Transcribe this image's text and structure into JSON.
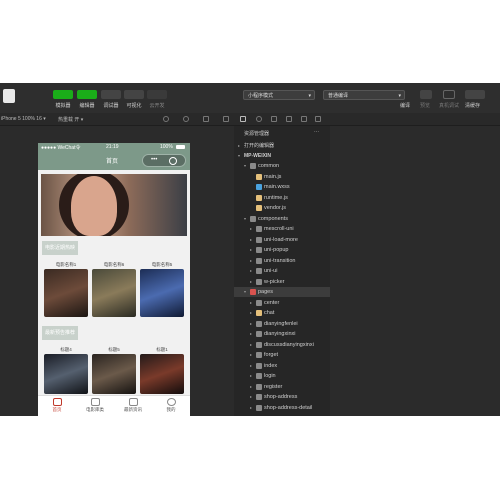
{
  "toolbar": {
    "buttons": [
      {
        "label": "模拟器",
        "color": "#1aad19",
        "glyph": "▯"
      },
      {
        "label": "编辑器",
        "color": "#1aad19",
        "glyph": "</>"
      },
      {
        "label": "调试器",
        "color": "#444444",
        "glyph": "⇆"
      },
      {
        "label": "可视化",
        "color": "#444444",
        "glyph": "▤"
      },
      {
        "label": "云开发",
        "color": "#3a3a3a",
        "glyph": "☁"
      }
    ],
    "mode_select": "小程序模式",
    "compile_select": "普通编译",
    "right_labels": [
      "编译",
      "预览",
      "真机调试",
      "清缓存"
    ]
  },
  "subbar": {
    "device": "iPhone 5 100% 16 ▾",
    "hotreload": "热重载 开 ▾",
    "explorer_title": "资源管理器",
    "explorer_more": "···"
  },
  "phone": {
    "carrier": "●●●●● WeChat令",
    "time": "21:19",
    "battery": "100%",
    "nav_title": "首页",
    "capsule_dots": "•••",
    "section1": "电影近期热映",
    "section2": "最新预告推荐",
    "row1": [
      "电影名称1",
      "电影名称6",
      "电影名称5"
    ],
    "row2": [
      "标题4",
      "标题5",
      "标题1"
    ],
    "tabs": [
      "首页",
      "电影库类",
      "最新资讯",
      "我的"
    ]
  },
  "explorer": {
    "open_editors": "打开的编辑器",
    "project": "MP-WEIXIN",
    "tree": [
      {
        "name": "common",
        "level": 1,
        "type": "folder-open"
      },
      {
        "name": "main.js",
        "level": 2,
        "type": "js"
      },
      {
        "name": "main.wxss",
        "level": 2,
        "type": "wxss"
      },
      {
        "name": "runtime.js",
        "level": 2,
        "type": "js"
      },
      {
        "name": "vendor.js",
        "level": 2,
        "type": "js"
      },
      {
        "name": "components",
        "level": 1,
        "type": "folder-open"
      },
      {
        "name": "mescroll-uni",
        "level": 2,
        "type": "folder"
      },
      {
        "name": "uni-load-more",
        "level": 2,
        "type": "folder"
      },
      {
        "name": "uni-popup",
        "level": 2,
        "type": "folder"
      },
      {
        "name": "uni-transition",
        "level": 2,
        "type": "folder"
      },
      {
        "name": "uni-ui",
        "level": 2,
        "type": "folder"
      },
      {
        "name": "w-picker",
        "level": 2,
        "type": "folder"
      },
      {
        "name": "pages",
        "level": 1,
        "type": "pages"
      },
      {
        "name": "center",
        "level": 2,
        "type": "folder"
      },
      {
        "name": "chat",
        "level": 2,
        "type": "folder-y"
      },
      {
        "name": "dianyingfenlei",
        "level": 2,
        "type": "folder"
      },
      {
        "name": "dianyingxinxi",
        "level": 2,
        "type": "folder"
      },
      {
        "name": "discussdianyingxinxi",
        "level": 2,
        "type": "folder"
      },
      {
        "name": "forget",
        "level": 2,
        "type": "folder"
      },
      {
        "name": "index",
        "level": 2,
        "type": "folder"
      },
      {
        "name": "login",
        "level": 2,
        "type": "folder"
      },
      {
        "name": "register",
        "level": 2,
        "type": "folder"
      },
      {
        "name": "shop-address",
        "level": 2,
        "type": "folder"
      },
      {
        "name": "shop-address-detail",
        "level": 2,
        "type": "folder"
      }
    ]
  },
  "colors": {
    "accent_green": "#1aad19",
    "theme": "#7d9989",
    "js": "#e5c07b",
    "wxss": "#4aa3df",
    "folder": "#8a8a8a",
    "pages": "#d9534f"
  }
}
